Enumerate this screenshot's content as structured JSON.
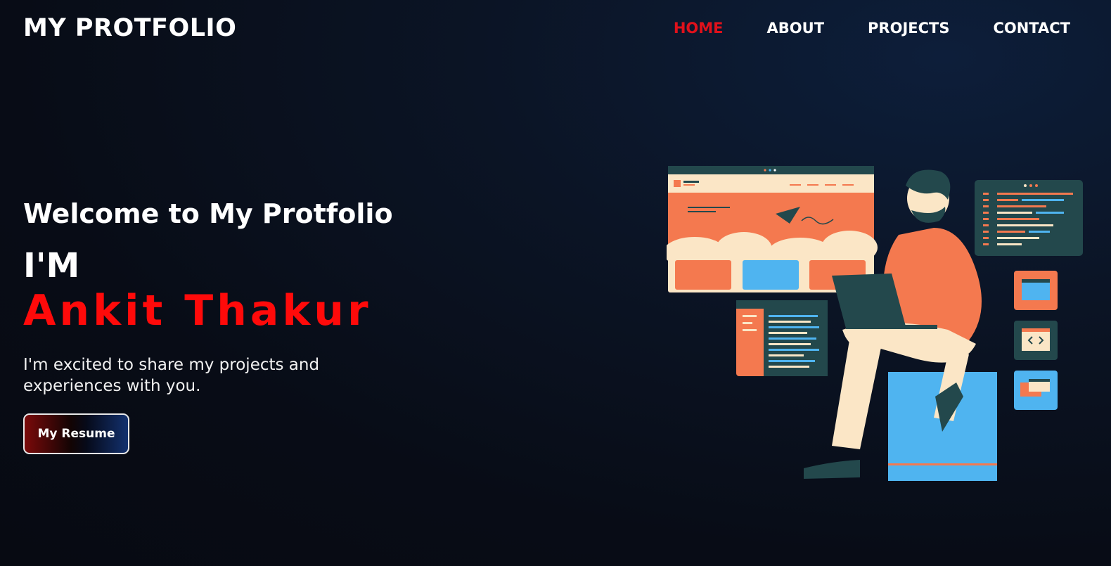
{
  "header": {
    "logo": "MY PROTFOLIO",
    "nav": [
      {
        "label": "HOME",
        "active": true
      },
      {
        "label": "ABOUT",
        "active": false
      },
      {
        "label": "PROJECTS",
        "active": false
      },
      {
        "label": "CONTACT",
        "active": false
      }
    ]
  },
  "hero": {
    "welcome": "Welcome to My Protfolio",
    "intro": "I'M",
    "name": "Ankit Thakur",
    "tagline": "I'm excited to share my projects and experiences with you.",
    "resume_button": "My Resume"
  },
  "illustration": {
    "icon": "developer-at-laptop-illustration"
  },
  "colors": {
    "accent_red": "#ff0a0a",
    "nav_active": "#e0111b",
    "illustration_orange": "#f4794f",
    "illustration_blue": "#4fb4f0",
    "illustration_cream": "#fbe6c6",
    "illustration_dark": "#23484c"
  }
}
